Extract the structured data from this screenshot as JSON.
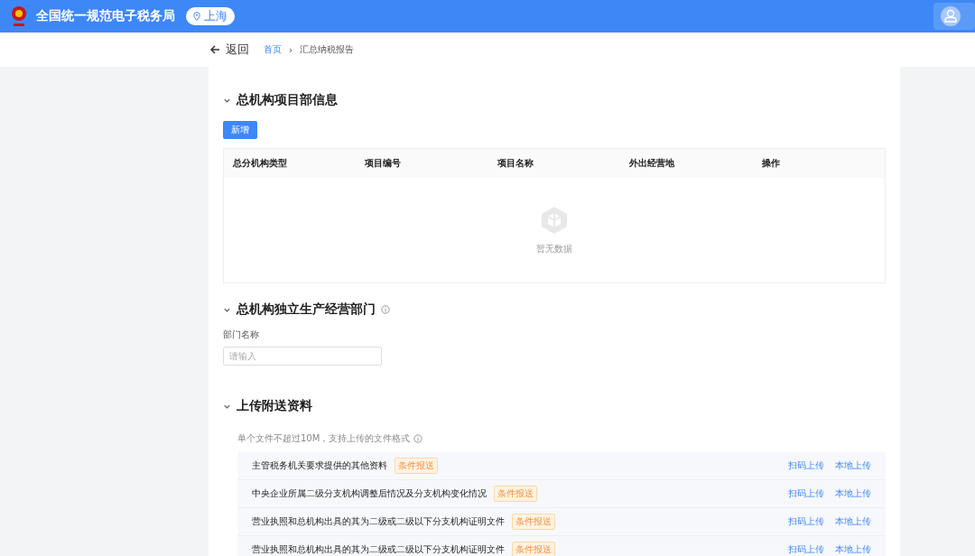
{
  "header": {
    "title": "全国统一规范电子税务局",
    "region": "上海"
  },
  "nav": {
    "back": "返回",
    "separator": "›",
    "breadcrumb": [
      {
        "label": "首页",
        "link": true
      },
      {
        "label": "汇总纳税报告",
        "link": false
      }
    ]
  },
  "project_section": {
    "title": "总机构项目部信息",
    "expanded": true,
    "add_button": "新增",
    "table": {
      "columns": [
        "总分机构类型",
        "项目编号",
        "项目名称",
        "外出经营地",
        "操作"
      ],
      "empty_text": "暂无数据"
    }
  },
  "department_section": {
    "title": "总机构独立生产经营部门",
    "expanded": true,
    "field_label": "部门名称",
    "placeholder": "请输入"
  },
  "upload_section": {
    "title": "上传附送资料",
    "expanded": true,
    "hint": "单个文件不超过10M，支持上传的文件格式",
    "items": [
      {
        "name": "主管税务机关要求提供的其他资料",
        "tag": "条件报送",
        "actions": [
          "扫码上传",
          "本地上传"
        ]
      },
      {
        "name": "中央企业所属二级分支机构调整后情况及分支机构变化情况",
        "tag": "条件报送",
        "actions": [
          "扫码上传",
          "本地上传"
        ]
      },
      {
        "name": "营业执照和总机构出具的其为二级或二级以下分支机构证明文件",
        "tag": "条件报送",
        "actions": [
          "扫码上传",
          "本地上传"
        ]
      },
      {
        "name": "营业执照和总机构出具的其为二级或二级以下分支机构证明文件",
        "tag": "条件报送",
        "actions": [
          "扫码上传",
          "本地上传"
        ]
      }
    ]
  }
}
